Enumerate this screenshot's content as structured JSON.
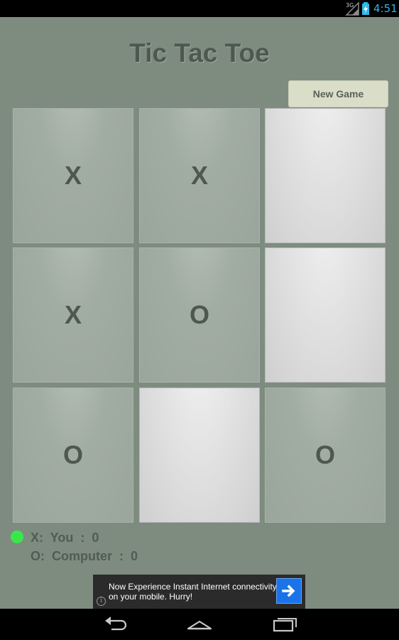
{
  "status_bar": {
    "network_label": "3G",
    "network_icon": "signal-icon",
    "battery_icon": "battery-charging-icon",
    "time": "4:51",
    "accent_color": "#33b5e5"
  },
  "app": {
    "title": "Tic Tac Toe",
    "new_game_label": "New Game",
    "background_color": "#7e8c80"
  },
  "board": {
    "cells": [
      {
        "mark": "X",
        "state": "filled"
      },
      {
        "mark": "X",
        "state": "filled"
      },
      {
        "mark": "",
        "state": "empty"
      },
      {
        "mark": "X",
        "state": "filled"
      },
      {
        "mark": "O",
        "state": "filled"
      },
      {
        "mark": "",
        "state": "empty"
      },
      {
        "mark": "O",
        "state": "filled"
      },
      {
        "mark": "",
        "state": "empty"
      },
      {
        "mark": "O",
        "state": "filled"
      }
    ]
  },
  "scores": {
    "x_line": "X:  You  :  0",
    "o_line": "O:  Computer  :  0",
    "turn_indicator_color": "#38e84a"
  },
  "ad": {
    "text": "Now Experience Instant Internet connectivity on your mobile. Hurry!",
    "info_icon": "info-icon",
    "arrow_icon": "arrow-right-icon"
  },
  "nav_bar": {
    "back_icon": "back-icon",
    "home_icon": "home-icon",
    "recents_icon": "recents-icon"
  }
}
